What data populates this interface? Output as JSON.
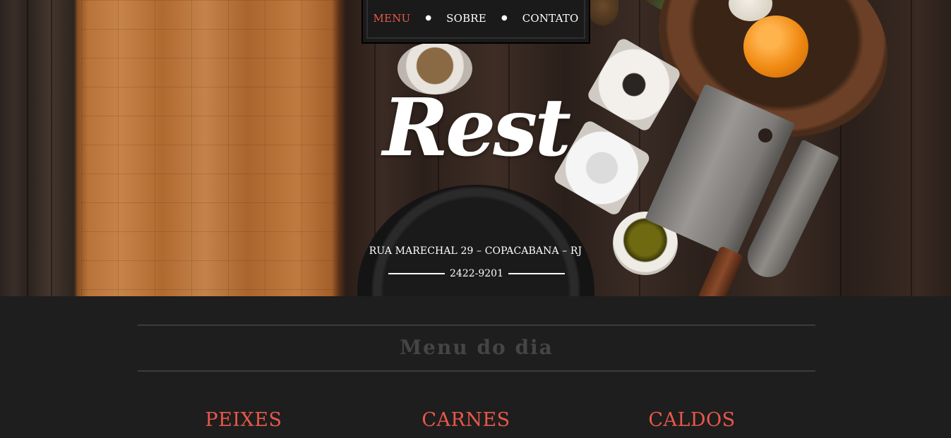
{
  "nav": {
    "items": [
      {
        "label": "MENU",
        "active": true
      },
      {
        "label": "SOBRE",
        "active": false
      },
      {
        "label": "CONTATO",
        "active": false
      }
    ]
  },
  "hero": {
    "logo": "Rest",
    "address": "RUA MARECHAL 29 – COPACABANA – RJ",
    "phone": "2422-9201"
  },
  "menu": {
    "title": "Menu do dia",
    "categories": [
      "PEIXES",
      "CARNES",
      "CALDOS"
    ]
  },
  "colors": {
    "accent": "#e9574a",
    "background": "#1e1e1e",
    "nav_background": "#1a1a1a",
    "muted_title": "#454545"
  }
}
